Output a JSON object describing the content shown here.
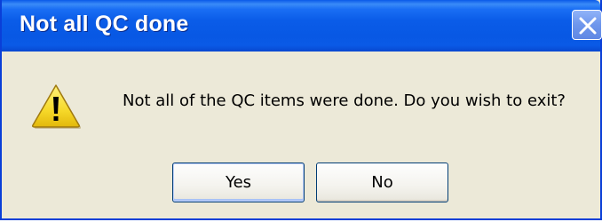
{
  "dialog": {
    "title": "Not all QC done",
    "message": "Not all of the QC items were done. Do you wish to exit?",
    "icon": "warning-icon",
    "buttons": {
      "yes_label": "Yes",
      "no_label": "No"
    },
    "close_icon": "close-icon"
  },
  "colors": {
    "titlebar": "#0a5ae8",
    "window_border": "#0a3fd8",
    "body_background": "#ece9d8",
    "title_text": "#ffffff",
    "warning_fill": "#f6d92a"
  }
}
